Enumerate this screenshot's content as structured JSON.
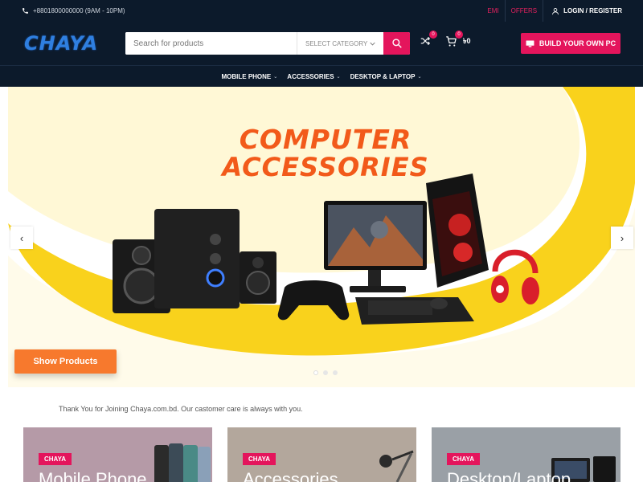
{
  "topbar": {
    "phone": "+8801800000000 (9AM - 10PM)",
    "emi": "EMI",
    "offers": "OFFERS",
    "login": "LOGIN / REGISTER"
  },
  "header": {
    "logo": "CHAYA",
    "search_placeholder": "Search for products",
    "category_label": "SELECT CATEGORY",
    "compare_count": "0",
    "cart_count": "0",
    "cart_total": "৳0",
    "build_label": "BUILD YOUR OWN PC"
  },
  "nav": {
    "items": [
      {
        "label": "MOBILE PHONE"
      },
      {
        "label": "ACCESSORIES"
      },
      {
        "label": "DESKTOP & LAPTOP"
      }
    ]
  },
  "hero": {
    "title_line1": "COMPUTER",
    "title_line2": "ACCESSORIES",
    "cta": "Show Products",
    "slide_count": 3,
    "active_slide": 1
  },
  "thanks_text": "Thank You for Joining Chaya.com.bd. Our castomer care is always with you.",
  "categories": [
    {
      "tag": "CHAYA",
      "name": "Mobile Phone",
      "bg": "#b59aa7"
    },
    {
      "tag": "CHAYA",
      "name": "Accessories",
      "bg": "#b3a79c"
    },
    {
      "tag": "CHAYA",
      "name": "Desktop/Laptop",
      "bg": "#9aa0a6"
    }
  ],
  "colors": {
    "navy": "#0c1a2b",
    "accent": "#e4155c",
    "cta": "#f7792d",
    "hero_yellow": "#f9d21c",
    "title_orange": "#f25a1a"
  }
}
